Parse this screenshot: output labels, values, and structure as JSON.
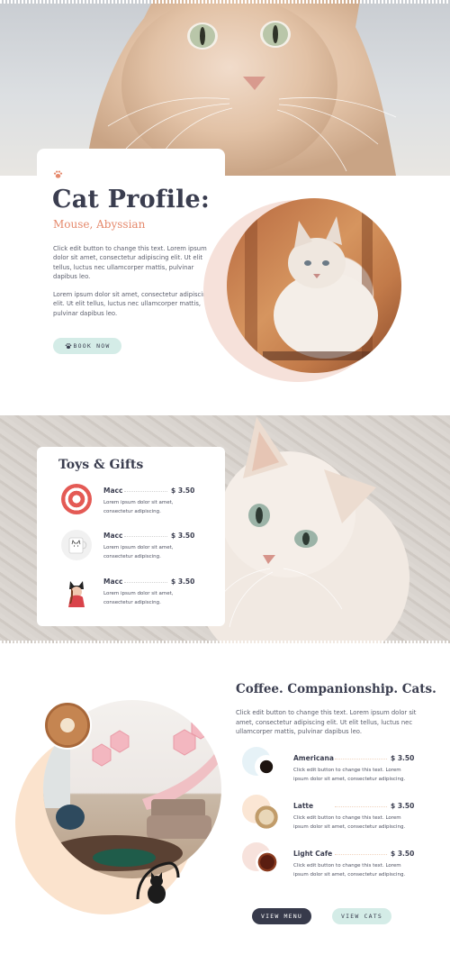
{
  "profile": {
    "title": "Cat Profile:",
    "subtitle": "Mouse, Abyssian",
    "paragraphs": [
      "Click edit button to change this text. Lorem ipsum dolor sit amet, consectetur adipiscing elit. Ut elit tellus, luctus nec ullamcorper mattis, pulvinar dapibus leo.",
      "Lorem ipsum dolor sit amet, consectetur adipiscing elit. Ut elit tellus, luctus nec ullamcorper mattis, pulvinar dapibus leo."
    ],
    "button_label": "BOOK NOW"
  },
  "toys": {
    "title": "Toys & Gifts",
    "items": [
      {
        "name": "Macc",
        "price": "$ 3.50",
        "desc": "Lorem ipsum dolor sit amet, consectetur adipiscing.",
        "icon": "swirl-candy-icon"
      },
      {
        "name": "Macc",
        "price": "$ 3.50",
        "desc": "Lorem ipsum dolor sit amet, consectetur adipiscing.",
        "icon": "cat-mug-icon"
      },
      {
        "name": "Macc",
        "price": "$ 3.50",
        "desc": "Lorem ipsum dolor sit amet, consectetur adipiscing.",
        "icon": "cat-ear-hat-icon"
      }
    ]
  },
  "coffee": {
    "title": "Coffee. Companionship. Cats.",
    "paragraph": "Click edit button to change this text. Lorem ipsum dolor sit amet, consectetur adipiscing elit. Ut elit tellus, luctus nec ullamcorper mattis, pulvinar dapibus leo.",
    "items": [
      {
        "name": "Americana",
        "price": "$ 3.50",
        "desc": "Click edit button to change this text. Lorem ipsum dolor sit amet, consectetur adipiscing.",
        "icon": "black-coffee-cup-icon"
      },
      {
        "name": "Latte",
        "price": "$ 3.50",
        "desc": "Click edit button to change this text. Lorem ipsum dolor sit amet, consectetur adipiscing.",
        "icon": "latte-cup-icon"
      },
      {
        "name": "Light Cafe",
        "price": "$ 3.50",
        "desc": "Click edit button to change this text. Lorem ipsum dolor sit amet, consectetur adipiscing.",
        "icon": "tea-cup-icon"
      }
    ],
    "view_menu_label": "VIEW MENU",
    "view_cats_label": "VIEW CATS"
  },
  "colors": {
    "accent_orange": "#e5896c",
    "mint": "#d4ece7",
    "dark": "#373a4b",
    "pink_arc": "#f6e1da",
    "peach_arc": "#fbe3cd"
  }
}
